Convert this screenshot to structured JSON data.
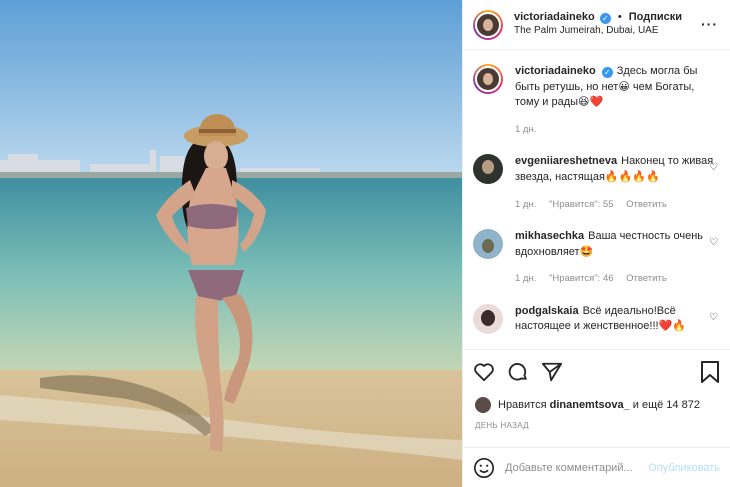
{
  "header": {
    "username": "victoriadaineko",
    "follow_label": "Подписки",
    "separator": "•",
    "location": "The Palm Jumeirah, Dubai, UAE"
  },
  "caption": {
    "username": "victoriadaineko",
    "text": "Здесь могла бы быть ретушь, но нет😀 чем Богаты, тому и рады😆❤️",
    "age": "1 дн."
  },
  "comments": [
    {
      "username": "evgeniiareshetneva",
      "text": "Наконец то живая звезда, настящая🔥🔥🔥🔥",
      "age": "1 дн.",
      "likes": "\"Нравится\": 55",
      "reply": "Ответить"
    },
    {
      "username": "mikhasechka",
      "text": "Ваша честность очень вдохновляет🤩",
      "age": "1 дн.",
      "likes": "\"Нравится\": 46",
      "reply": "Ответить"
    },
    {
      "username": "podgalskaia",
      "text": "Всё идеально!Всё настоящее и женственное!!!❤️🔥",
      "age": "",
      "likes": "",
      "reply": ""
    }
  ],
  "likes": {
    "prefix": "Нравится",
    "user": "dinanemtsova_",
    "suffix": "и ещё 14 872"
  },
  "timestamp": "ДЕНЬ НАЗАД",
  "add_comment": {
    "placeholder": "Добавьте комментарий...",
    "publish_label": "Опубликовать"
  },
  "icons": {
    "verified": "verified-badge-icon",
    "more": "more-options-icon",
    "like": "heart-icon",
    "comment": "comment-icon",
    "share": "paper-plane-icon",
    "save": "bookmark-icon",
    "emoji": "smiley-icon"
  },
  "colors": {
    "link_disabled": "#b2dffc",
    "muted": "#8e8e8e",
    "verified": "#3897f0"
  }
}
